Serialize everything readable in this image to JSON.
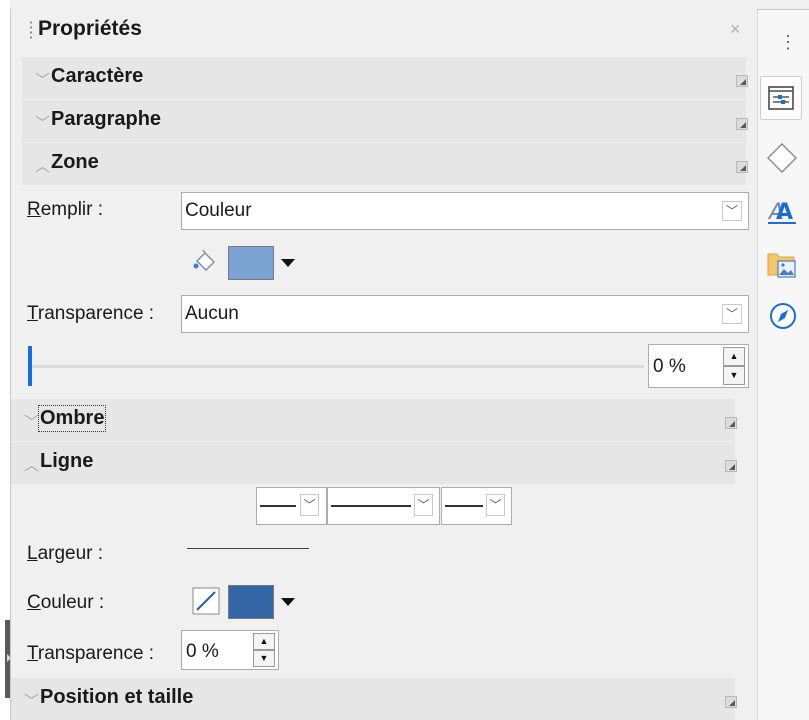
{
  "sidebar": {
    "title": "Propriétés",
    "close_glyph": "×",
    "menu_glyph": "⋮"
  },
  "sections": {
    "caractere": "Caractère",
    "paragraphe": "Paragraphe",
    "zone": "Zone",
    "ombre": "Ombre",
    "ligne": "Ligne",
    "position": "Position et taille"
  },
  "zone": {
    "fill_label_accel": "R",
    "fill_label_rest": "emplir :",
    "fill_value": "Couleur",
    "fill_color": "#7ba3d4",
    "transparency_label_accel": "T",
    "transparency_label_rest": "ransparence :",
    "transparency_value": "Aucun",
    "transparency_slider_fraction": 0,
    "transparency_percent": "0 %"
  },
  "ligne": {
    "width_label_accel": "L",
    "width_label_rest": "argeur :",
    "color_label_accel": "C",
    "color_label_rest": "ouleur :",
    "line_color": "#3465a4",
    "transparency_label_accel": "T",
    "transparency_label_rest": "ransparence :",
    "transparency_value": "0 %"
  },
  "tabs": [
    {
      "name": "properties-icon"
    },
    {
      "name": "shapes-icon"
    },
    {
      "name": "styles-icon"
    },
    {
      "name": "gallery-icon"
    },
    {
      "name": "navigator-icon"
    }
  ],
  "colors": {
    "accent": "#1c6fd0",
    "header_bg": "#e6e6e6",
    "panel_bg": "#f0f0f0"
  }
}
